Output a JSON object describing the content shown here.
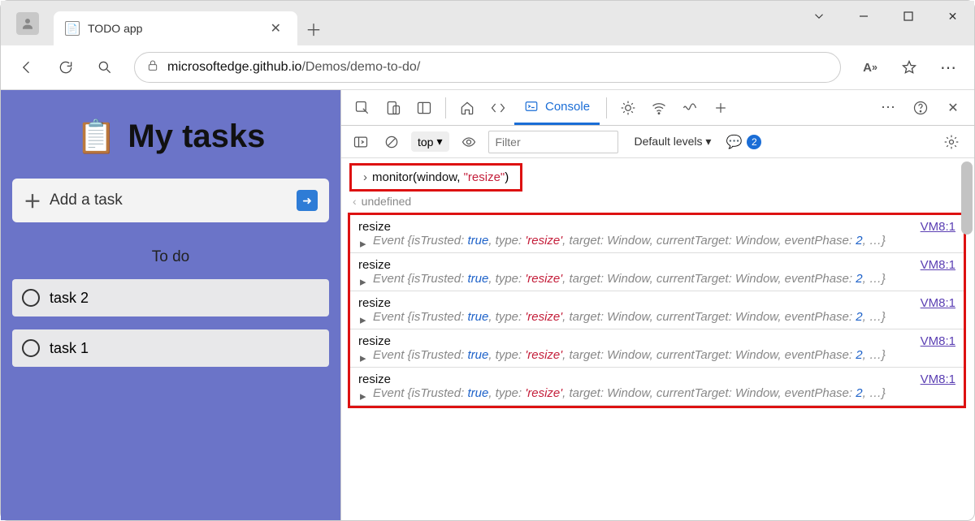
{
  "window": {
    "tab_title": "TODO app",
    "url_host": "microsoftedge.github.io",
    "url_path": "/Demos/demo-to-do/"
  },
  "todo": {
    "heading": "My tasks",
    "add_placeholder": "Add a task",
    "section_label": "To do",
    "tasks": [
      "task 2",
      "task 1"
    ]
  },
  "devtools": {
    "console_tab_label": "Console",
    "context": "top",
    "filter_placeholder": "Filter",
    "levels_label": "Default levels",
    "issue_count": "2",
    "command": {
      "fn": "monitor",
      "arg1": "window",
      "arg2": "\"resize\""
    },
    "return_value": "undefined",
    "event_source": "VM8:1",
    "events": [
      {
        "name": "resize",
        "isTrusted": "true",
        "type": "'resize'",
        "target": "Window",
        "currentTarget": "Window",
        "eventPhase": "2"
      },
      {
        "name": "resize",
        "isTrusted": "true",
        "type": "'resize'",
        "target": "Window",
        "currentTarget": "Window",
        "eventPhase": "2"
      },
      {
        "name": "resize",
        "isTrusted": "true",
        "type": "'resize'",
        "target": "Window",
        "currentTarget": "Window",
        "eventPhase": "2"
      },
      {
        "name": "resize",
        "isTrusted": "true",
        "type": "'resize'",
        "target": "Window",
        "currentTarget": "Window",
        "eventPhase": "2"
      },
      {
        "name": "resize",
        "isTrusted": "true",
        "type": "'resize'",
        "target": "Window",
        "currentTarget": "Window",
        "eventPhase": "2"
      }
    ]
  }
}
